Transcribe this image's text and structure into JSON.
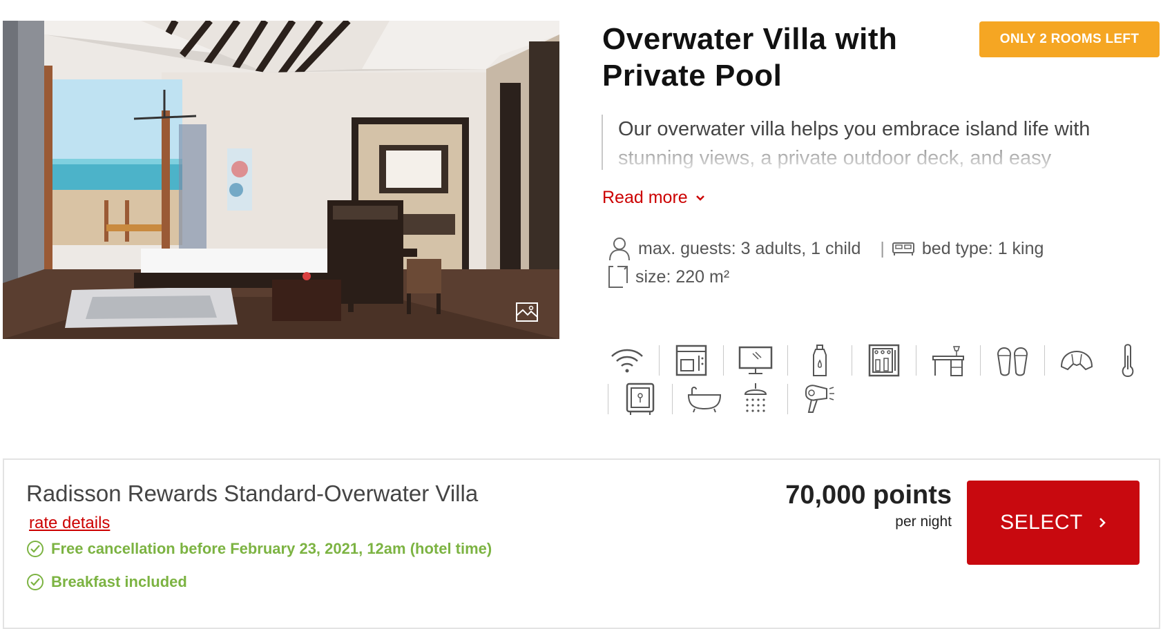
{
  "room": {
    "title": "Overwater Villa with Private Pool",
    "availability_badge": "ONLY 2 ROOMS LEFT",
    "description": "Our overwater villa helps you embrace island life with stunning views, a private outdoor deck, and easy",
    "read_more_label": "Read more",
    "specs": {
      "guests": "max. guests: 3 adults, 1 child",
      "bed": "bed type: 1 king",
      "size": "size: 220 m²"
    },
    "amenities": [
      "wifi-icon",
      "coffee-maker-icon",
      "tv-icon",
      "water-bottle-icon",
      "minibar-icon",
      "desk-icon",
      "slippers-icon",
      "croissant-icon",
      "thermometer-icon",
      "safe-icon",
      "bathtub-icon",
      "shower-icon",
      "hairdryer-icon"
    ]
  },
  "rate": {
    "name": "Radisson Rewards Standard-Overwater Villa",
    "details_link": "rate details",
    "perks": [
      "Free cancellation before February 23, 2021, 12am (hotel time)",
      "Breakfast included"
    ],
    "price": "70,000 points",
    "price_unit": "per night",
    "select_label": "SELECT"
  },
  "colors": {
    "accent_red": "#c8090f",
    "badge_orange": "#f5a623",
    "perk_green": "#7cb342"
  }
}
